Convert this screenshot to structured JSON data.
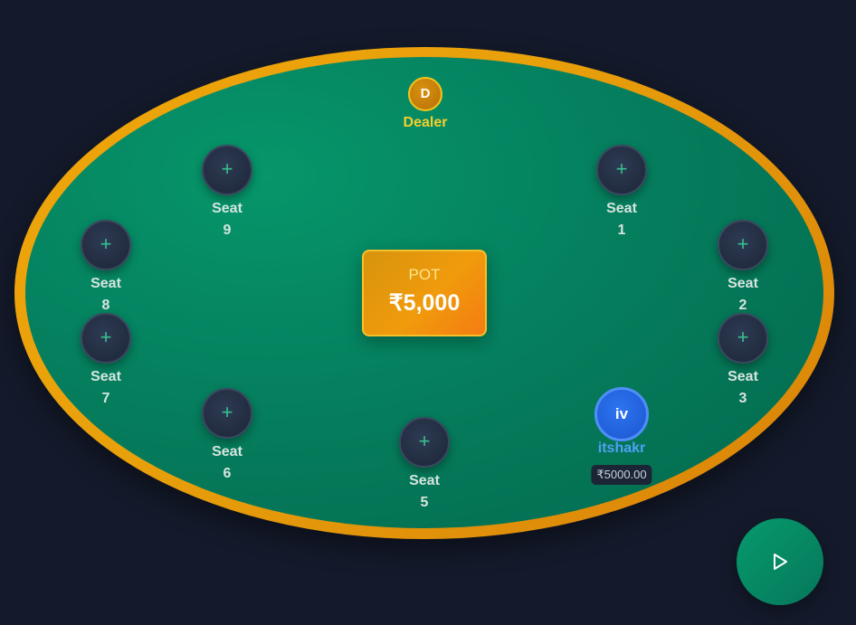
{
  "dealer": {
    "chip": "D",
    "label": "Dealer"
  },
  "pot": {
    "label": "POT",
    "amount": "₹5,000"
  },
  "seat_icon": "+",
  "seats": [
    {
      "label": "Seat\n1"
    },
    {
      "label": "Seat\n2"
    },
    {
      "label": "Seat\n3"
    },
    {
      "label": "Seat\n5"
    },
    {
      "label": "Seat\n6"
    },
    {
      "label": "Seat\n7"
    },
    {
      "label": "Seat\n8"
    },
    {
      "label": "Seat\n9"
    }
  ],
  "player": {
    "initials": "iv",
    "name": "itshakr",
    "stack": "₹5000.00"
  },
  "colors": {
    "background": "#141a2b",
    "felt": "#057f5e",
    "rail": "#e8a00b",
    "accent": "#36c08d",
    "player": "#2d74f0"
  },
  "icons": {
    "play": "play-icon",
    "seat": "plus-icon"
  }
}
